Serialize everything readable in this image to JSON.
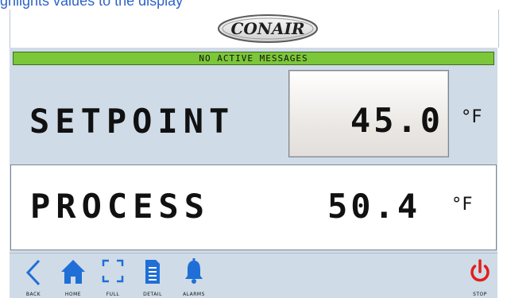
{
  "top_bar": {
    "text": "ghlights values to the display"
  },
  "header": {
    "logo_text": "CONAIR"
  },
  "messages": {
    "text": "NO ACTIVE MESSAGES"
  },
  "setpoint": {
    "label": "SETPOINT",
    "value": "45.0",
    "unit": "°F"
  },
  "process": {
    "label": "PROCESS",
    "value": "50.4",
    "unit": "°F"
  },
  "footer": {
    "back_label": "BACK",
    "home_label": "HOME",
    "full_label": "FULL",
    "detail_label": "DETAIL",
    "alarms_label": "ALARMS",
    "stop_label": "STOP"
  },
  "colors": {
    "panel_background": "#cfdbe7",
    "message_bar": "#7cc63a",
    "nav_icon_blue": "#1f6fd6",
    "stop_red": "#e0201b"
  },
  "icons": [
    "chevron-left-icon",
    "home-icon",
    "fullscreen-icon",
    "document-icon",
    "bell-icon",
    "power-icon"
  ]
}
